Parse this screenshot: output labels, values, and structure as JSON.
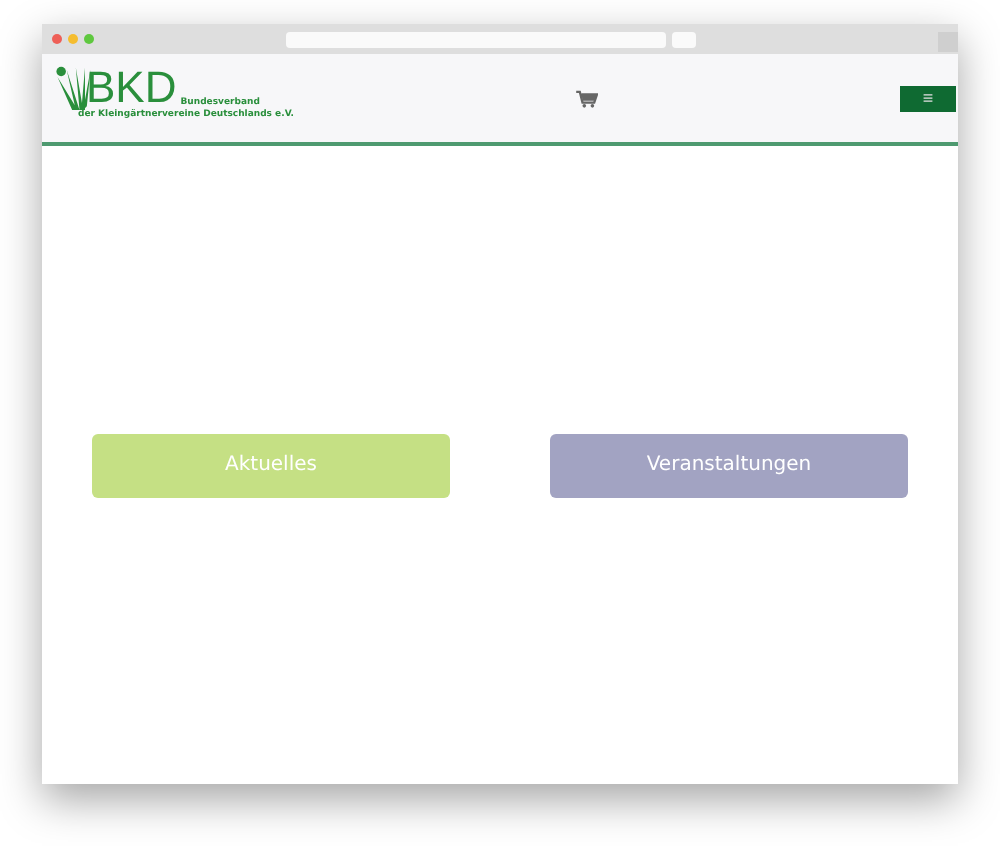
{
  "logo": {
    "mark": "BKD",
    "line_1": "Bundesverband",
    "line_2": "der Kleingärtnervereine Deutschlands e.V."
  },
  "menu_button": {
    "label": "≡"
  },
  "tiles": [
    {
      "label": "Aktuelles",
      "color": "#c5e084"
    },
    {
      "label": "Veranstaltungen",
      "color": "#a2a3c2"
    }
  ]
}
